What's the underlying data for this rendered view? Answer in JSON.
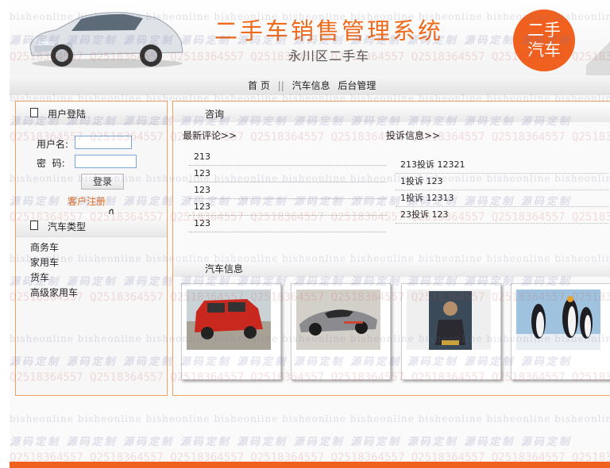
{
  "header": {
    "title": "二手车销售管理系统",
    "subtitle": "永川区二手车",
    "logo_line1": "二手",
    "logo_line2": "汽车"
  },
  "nav": {
    "items": [
      "首 页",
      "汽车信息",
      "后台管理"
    ],
    "separator": "||"
  },
  "sidebar": {
    "login_title": "用户登陆",
    "username_label": "用户名:",
    "username_value": "",
    "password_label": "密  码:",
    "password_value": "",
    "login_button": "登录",
    "register_link": "客户注册",
    "types_title": "汽车类型",
    "types": [
      "商务车",
      "家用车",
      "货车",
      "高级家用车"
    ]
  },
  "main": {
    "consult_title": "咨询",
    "comments_title": "最新评论>>",
    "comments": [
      "213",
      "123",
      "123",
      "123",
      "123"
    ],
    "complaints_title": "投诉信息>>",
    "complaints": [
      "213投诉  12321",
      "1投诉  123",
      "1投诉  12313",
      "23投诉  123"
    ],
    "cars_title": "汽车信息",
    "cars": [
      {
        "kind": "red-boxy-car"
      },
      {
        "kind": "silver-supercar"
      },
      {
        "kind": "thor-poster"
      },
      {
        "kind": "penguins"
      }
    ]
  },
  "watermarks": {
    "site": "bisheonline",
    "code": "源码定制",
    "qq": "Q2518364557"
  },
  "colors": {
    "accent": "#f0611f",
    "title": "#ee6a1c",
    "border": "#f0a060"
  }
}
